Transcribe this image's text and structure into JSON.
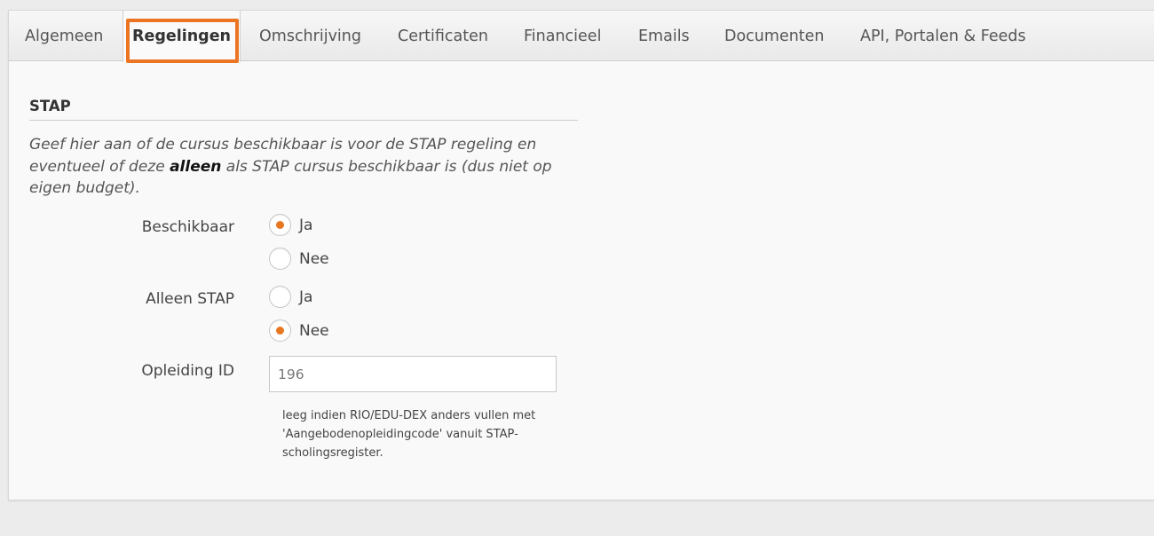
{
  "tabs": [
    {
      "label": "Algemeen",
      "active": false
    },
    {
      "label": "Regelingen",
      "active": true
    },
    {
      "label": "Omschrijving",
      "active": false
    },
    {
      "label": "Certificaten",
      "active": false
    },
    {
      "label": "Financieel",
      "active": false
    },
    {
      "label": "Emails",
      "active": false
    },
    {
      "label": "Documenten",
      "active": false
    },
    {
      "label": "API, Portalen & Feeds",
      "active": false
    }
  ],
  "highlight_color": "#ec7524",
  "accent_color": "#e87722",
  "section": {
    "title": "STAP",
    "description_before": "Geef hier aan of de cursus beschikbaar is voor de STAP regeling en eventueel of deze ",
    "description_bold": "alleen",
    "description_after": " als STAP cursus beschikbaar is (dus niet op eigen budget)."
  },
  "fields": {
    "beschikbaar": {
      "label": "Beschikbaar",
      "options": [
        {
          "label": "Ja",
          "checked": true
        },
        {
          "label": "Nee",
          "checked": false
        }
      ]
    },
    "alleen_stap": {
      "label": "Alleen STAP",
      "options": [
        {
          "label": "Ja",
          "checked": false
        },
        {
          "label": "Nee",
          "checked": true
        }
      ]
    },
    "opleiding_id": {
      "label": "Opleiding ID",
      "value": "196",
      "help": "leeg indien RIO/EDU-DEX anders vullen met 'Aangebodenopleidingcode' vanuit STAP-scholingsregister."
    }
  }
}
